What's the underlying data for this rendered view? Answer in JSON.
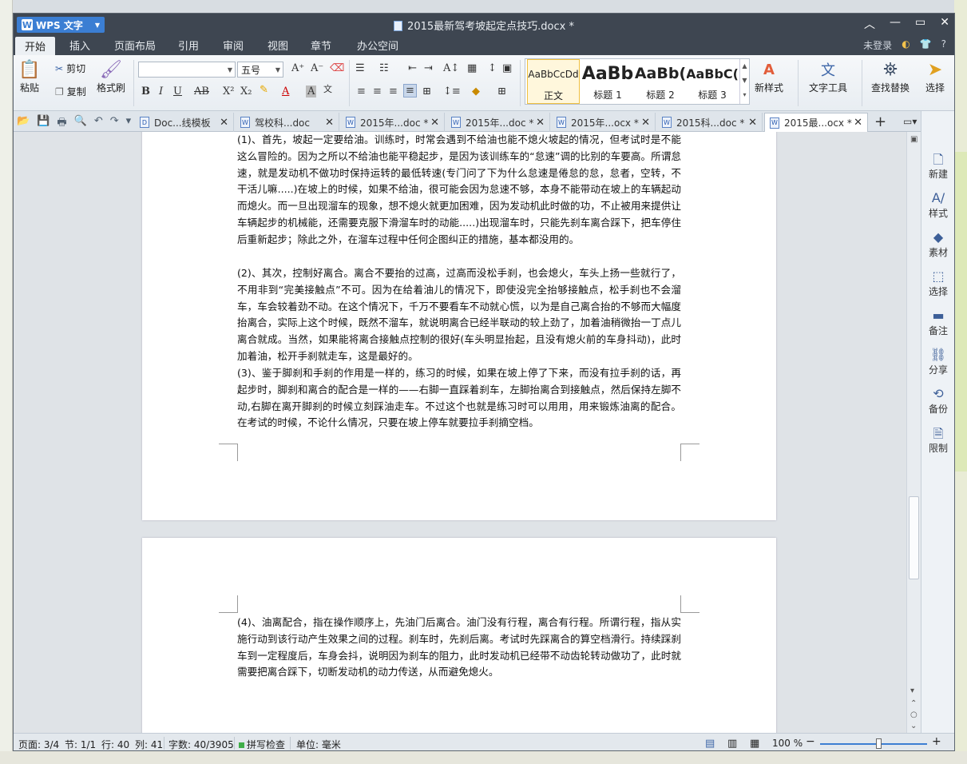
{
  "app": {
    "name": "WPS 文字",
    "document_title": "2015最新驾考坡起定点技巧.docx *"
  },
  "menu_tabs": [
    "开始",
    "插入",
    "页面布局",
    "引用",
    "审阅",
    "视图",
    "章节",
    "办公空间"
  ],
  "menu_right": {
    "login": "未登录",
    "help": "?"
  },
  "ribbon": {
    "paste": "粘贴",
    "cut": "剪切",
    "copy": "复制",
    "format_painter": "格式刷",
    "font_name": "",
    "font_size": "五号",
    "styles": [
      {
        "preview": "AaBbCcDd",
        "label": "正文"
      },
      {
        "preview": "AaBb",
        "label": "标题 1"
      },
      {
        "preview": "AaBb(",
        "label": "标题 2"
      },
      {
        "preview": "AaBbC(",
        "label": "标题 3"
      }
    ],
    "new_style": "新样式",
    "text_tools": "文字工具",
    "find_replace": "查找替换",
    "select": "选择"
  },
  "doc_tabs": [
    {
      "label": "Doc...线模板",
      "active": false
    },
    {
      "label": "驾校科...doc",
      "active": false
    },
    {
      "label": "2015年...doc *",
      "active": false
    },
    {
      "label": "2015年...doc *",
      "active": false
    },
    {
      "label": "2015年...ocx *",
      "active": false
    },
    {
      "label": "2015科...doc *",
      "active": false
    },
    {
      "label": "2015最...ocx *",
      "active": true
    }
  ],
  "document": {
    "page1_paragraphs": [
      "(1)、首先，坡起一定要给油。训练时，时常会遇到不给油也能不熄火坡起的情况，但考试时是不能这么冒险的。因为之所以不给油也能平稳起步，是因为该训练车的“怠速”调的比别的车要高。所谓怠速，就是发动机不做功时保持运转的最低转速(专门问了下为什么怠速是倦怠的怠，怠者，空转，不干活儿嘛.....)在坡上的时候，如果不给油，很可能会因为怠速不够，本身不能带动在坡上的车辆起动而熄火。而一旦出现溜车的现象，想不熄火就更加困难，因为发动机此时做的功，不止被用来提供让车辆起步的机械能，还需要克服下滑溜车时的动能.....)出现溜车时，只能先刹车离合踩下，把车停住后重新起步；除此之外，在溜车过程中任何企图纠正的措施，基本都没用的。",
      "(2)、其次，控制好离合。离合不要抬的过高，过高而没松手刹，也会熄火，车头上扬一些就行了，不用非到“完美接触点”不可。因为在给着油儿的情况下，即使没完全抬够接触点，松手刹也不会溜车，车会较着劲不动。在这个情况下，千万不要看车不动就心慌，以为是自己离合抬的不够而大幅度抬离合，实际上这个时候，既然不溜车，就说明离合已经半联动的较上劲了，加着油稍微抬一丁点儿离合就成。当然，如果能将离合接触点控制的很好(车头明显抬起，且没有熄火前的车身抖动)，此时加着油，松开手刹就走车，这是最好的。",
      "(3)、鉴于脚刹和手刹的作用是一样的，练习的时候，如果在坡上停了下来，而没有拉手刹的话，再起步时，脚刹和离合的配合是一样的——右脚一直踩着刹车，左脚抬离合到接触点，然后保持左脚不动,右脚在离开脚刹的时候立刻踩油走车。不过这个也就是练习时可以用用，用来锻炼油离的配合。在考试的时候，不论什么情况，只要在坡上停车就要拉手刹摘空档。"
    ],
    "page2_paragraphs": [
      "(4)、油离配合，指在操作顺序上，先油门后离合。油门没有行程，离合有行程。所谓行程，指从实施行动到该行动产生效果之间的过程。刹车时，先刹后离。考试时先踩离合的算空档滑行。持续踩刹车到一定程度后，车身会抖，说明因为刹车的阻力，此时发动机已经带不动齿轮转动做功了，此时就需要把离合踩下，切断发动机的动力传送，从而避免熄火。"
    ]
  },
  "right_panel": [
    "新建",
    "样式",
    "素材",
    "选择",
    "备注",
    "分享",
    "备份",
    "限制"
  ],
  "status": {
    "page": "页面: 3/4",
    "section": "节: 1/1",
    "line": "行: 40",
    "column": "列: 41",
    "word_count": "字数: 40/3905",
    "spell_check": "拼写检查",
    "unit": "单位: 毫米",
    "zoom": "100 %",
    "zoom_level": 0.55
  }
}
